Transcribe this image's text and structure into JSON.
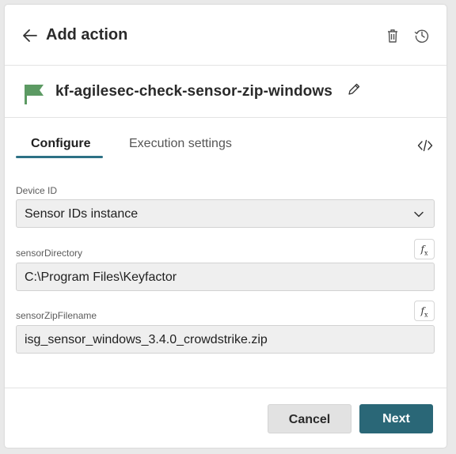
{
  "header": {
    "title": "Add action",
    "icons": [
      "arrow-left-icon",
      "trash-icon",
      "history-icon"
    ]
  },
  "action": {
    "name": "kf-agilesec-check-sensor-zip-windows",
    "flag_color": "#5c9a63"
  },
  "tabs": [
    {
      "label": "Configure",
      "active": true
    },
    {
      "label": "Execution settings",
      "active": false
    }
  ],
  "fields": {
    "device_id": {
      "label": "Device ID",
      "value": "Sensor IDs instance"
    },
    "sensor_directory": {
      "label": "sensorDirectory",
      "value": "C:\\Program Files\\Keyfactor"
    },
    "sensor_zip_filename": {
      "label": "sensorZipFilename",
      "value": "isg_sensor_windows_3.4.0_crowdstrike.zip"
    }
  },
  "footer": {
    "cancel_label": "Cancel",
    "next_label": "Next"
  },
  "colors": {
    "accent": "#2d7185",
    "primary_button": "#2a6777"
  }
}
